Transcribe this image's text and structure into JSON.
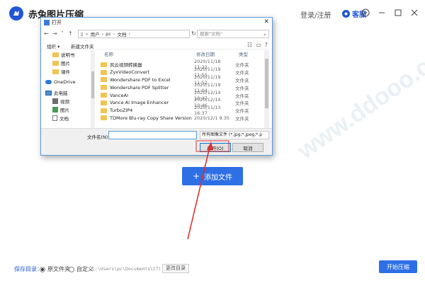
{
  "app": {
    "title": "赤兔图片压缩",
    "login_label": "登录/注册",
    "support_label": "客服",
    "add_files_label": "添加文件",
    "save_dir_label": "保存目录：",
    "radio_original": "原文件夹",
    "radio_custom": "自定义",
    "selected_radio": "原文件夹",
    "save_path": "C:\\Users\\pc\\Documents\\CTImageCo",
    "change_dir_label": "更改目录",
    "start_label": "开始压缩",
    "watermark_text": "www.ddooo.com",
    "accent_color": "#2e6fe5"
  },
  "dialog": {
    "title": "打开",
    "address": [
      "用户",
      "pc",
      "文档"
    ],
    "search_placeholder": "搜索\"文档\"",
    "toolbar": {
      "organize": "组织 ▾",
      "new_folder": "新建文件夹"
    },
    "nav_items": [
      {
        "label": "说明书",
        "icon": "folder-icon"
      },
      {
        "label": "图片",
        "icon": "folder-icon"
      },
      {
        "label": "课件",
        "icon": "folder-icon"
      },
      {
        "label": "OneDrive",
        "icon": "cloud-icon"
      },
      {
        "label": "此电脑",
        "icon": "computer-icon"
      },
      {
        "label": "视频",
        "icon": "video-icon"
      },
      {
        "label": "图片",
        "icon": "image-icon"
      },
      {
        "label": "文档",
        "icon": "document-icon"
      }
    ],
    "columns": {
      "name": "名称",
      "date": "修改日期",
      "type": "类型"
    },
    "files": [
      {
        "name": "风云视频转换器",
        "date": "2020/11/18 11:22",
        "type": "文件夹"
      },
      {
        "name": "ZyxVideoConvert",
        "date": "2020/11/19 11:55",
        "type": "文件夹"
      },
      {
        "name": "Wondershare PDF to Excel",
        "date": "2020/11/19 11:52",
        "type": "文件夹"
      },
      {
        "name": "Wondershare PDF Splitter",
        "date": "2020/11/19 11:04",
        "type": "文件夹"
      },
      {
        "name": "VanceAI",
        "date": "2020/12/14 10:47",
        "type": "文件夹"
      },
      {
        "name": "Vance AI Image Enhancer",
        "date": "2020/12/14 10:46",
        "type": "文件夹"
      },
      {
        "name": "TurboZIP4",
        "date": "2020/11/13 16:37",
        "type": "文件夹"
      },
      {
        "name": "TDMore Blu-ray Copy Share Version",
        "date": "2020/12/1 9:35",
        "type": "文件夹"
      }
    ],
    "filename_label": "文件名(N):",
    "filename_value": "",
    "filter_value": "所有图像文件 (*.jpg;*.jpeg;*.p",
    "open_label": "打开(O)",
    "cancel_label": "取消"
  }
}
